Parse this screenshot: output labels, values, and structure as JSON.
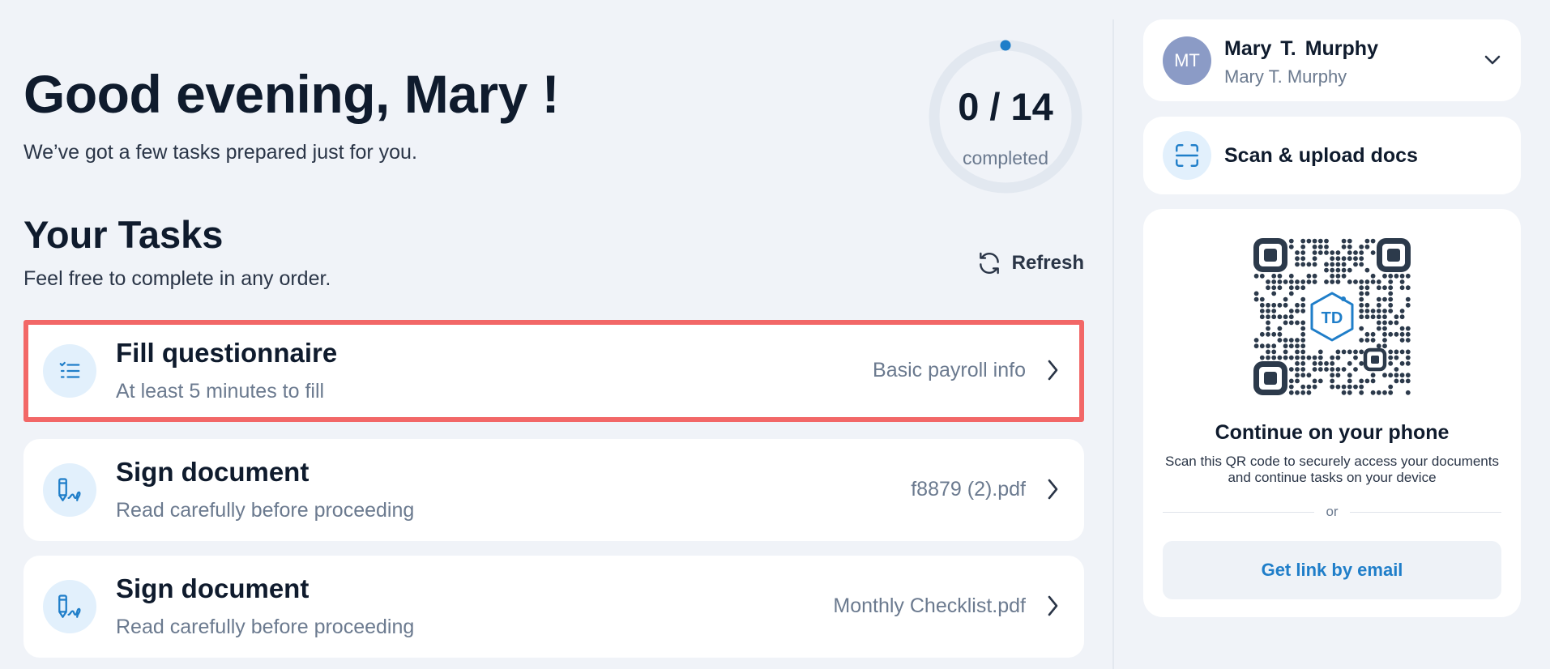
{
  "header": {
    "greeting": "Good evening, Mary !",
    "subtitle": "We’ve got a few tasks prepared just for you."
  },
  "progress": {
    "label_count": "0 / 14",
    "label_text": "completed",
    "completed": 0,
    "total": 14
  },
  "tasks_section": {
    "title": "Your Tasks",
    "subtitle": "Feel free to complete in any order.",
    "refresh_label": "Refresh",
    "items": [
      {
        "title": "Fill questionnaire",
        "subtitle": "At least 5 minutes to fill",
        "meta": "Basic payroll info",
        "icon": "checklist-icon",
        "selected": true
      },
      {
        "title": "Sign document",
        "subtitle": "Read carefully before proceeding",
        "meta": "f8879 (2).pdf",
        "icon": "sign-document-icon",
        "selected": false
      },
      {
        "title": "Sign document",
        "subtitle": "Read carefully before proceeding",
        "meta": "Monthly Checklist.pdf",
        "icon": "sign-document-icon",
        "selected": false
      }
    ]
  },
  "user": {
    "initials": "MT",
    "name": "Mary  T.  Murphy",
    "subname": "Mary T. Murphy"
  },
  "scan": {
    "label": "Scan & upload docs"
  },
  "phone": {
    "qr_logo_text": "TD",
    "title": "Continue on your phone",
    "description": "Scan this QR code to securely access your documents and continue tasks on your device",
    "or_text": "or",
    "email_button": "Get link by email"
  },
  "colors": {
    "accent": "#1f7ec9",
    "selected_border": "#f26767",
    "background": "#f0f3f8",
    "card": "#ffffff",
    "icon_bg": "#e2f0fc",
    "avatar": "#8b9bc6",
    "progress_track": "#e2e8f0"
  }
}
